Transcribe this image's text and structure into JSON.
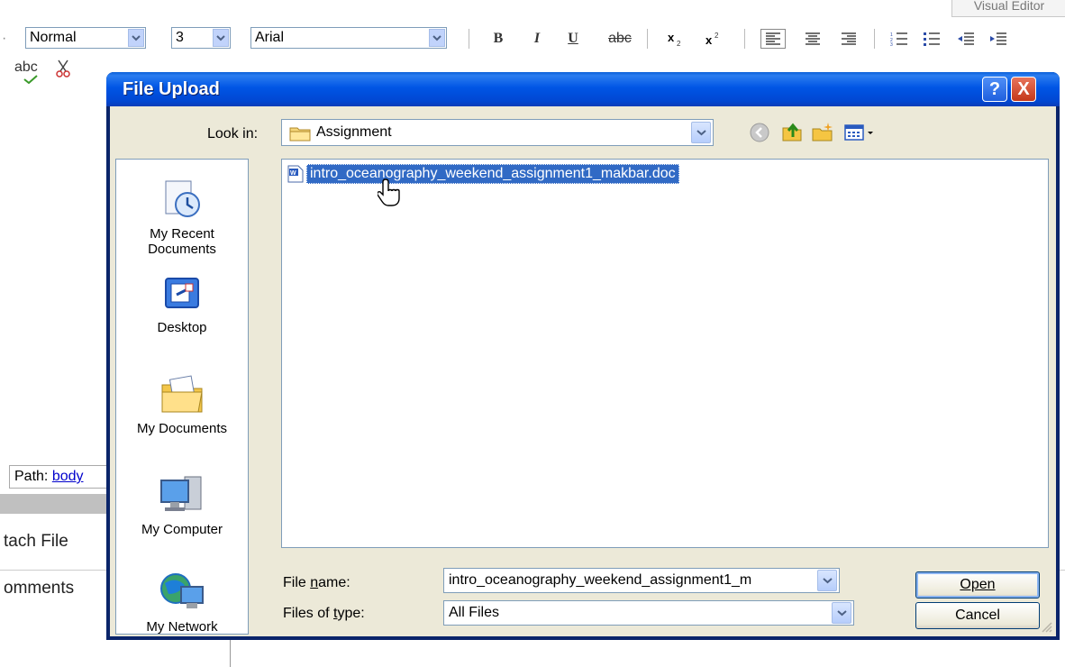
{
  "editor": {
    "tab_label": "Visual Editor",
    "format_value": "Normal",
    "size_value": "3",
    "font_value": "Arial",
    "format_buttons": [
      "B",
      "I",
      "U",
      "abc"
    ],
    "path_label": "Path:",
    "path_link": "body",
    "side_labels": [
      "tach File",
      "omments"
    ],
    "spell_label": "abc"
  },
  "dialog": {
    "title": "File Upload",
    "help_label": "?",
    "close_label": "X",
    "lookin_label": "Look in:",
    "lookin_value": "Assignment",
    "places": [
      {
        "label": "My Recent Documents",
        "icon": "recent-documents-icon"
      },
      {
        "label": "Desktop",
        "icon": "desktop-icon"
      },
      {
        "label": "My Documents",
        "icon": "my-documents-icon"
      },
      {
        "label": "My Computer",
        "icon": "my-computer-icon"
      },
      {
        "label": "My Network",
        "icon": "my-network-icon"
      }
    ],
    "files": [
      {
        "name": "intro_oceanography_weekend_assignment1_makbar.doc",
        "icon": "word-document-icon",
        "selected": true
      }
    ],
    "filename_label": "File name:",
    "filename_value": "intro_oceanography_weekend_assignment1_m",
    "filetype_label": "Files of type:",
    "filetype_value": "All Files",
    "open_label": "Open",
    "cancel_label": "Cancel"
  },
  "colors": {
    "title_bar": "#0055e5",
    "dialog_body": "#ece9d8",
    "selection": "#316ac5",
    "close_button": "#c4381a"
  }
}
